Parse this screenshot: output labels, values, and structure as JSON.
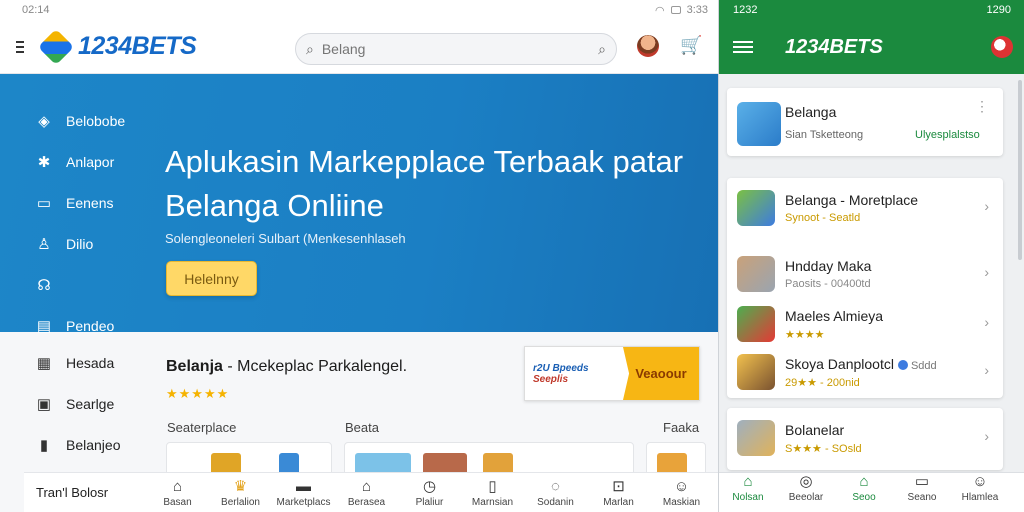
{
  "left": {
    "status_time": "02:14",
    "status_right": "3:33",
    "brand": "1234BETS",
    "search": {
      "placeholder": "Belang"
    },
    "side_menu": [
      {
        "label": "Belobobe",
        "icon": "leaf-icon"
      },
      {
        "label": "Anlapor",
        "icon": "puzzle-icon"
      },
      {
        "label": "Eenens",
        "icon": "laptop-icon"
      },
      {
        "label": "Dilio",
        "icon": "person-icon"
      },
      {
        "label": "",
        "icon": "headset-icon"
      },
      {
        "label": "Pendeo",
        "icon": "chart-icon"
      }
    ],
    "hero": {
      "title": "Aplukasin Markepplace Terbaak patar Belanga Onliine",
      "subtitle": "Solengleoneleri Sulbart (Menkesenhlaseh",
      "button": "Helelnny"
    },
    "lower_menu": [
      {
        "label": "Hesada",
        "icon": "storefront-icon"
      },
      {
        "label": "Searlge",
        "icon": "document-icon"
      },
      {
        "label": "Belanjeo",
        "icon": "bag-icon"
      }
    ],
    "section": {
      "title_bold": "Belanja",
      "title_rest": " - Mcekeplac Parkalengel.",
      "stars": "★★★★★",
      "col1": "Seaterplace",
      "col2": "Beata",
      "col3": "Faaka"
    },
    "promo": {
      "line1": "r2U Bpeeds",
      "line2": "Seeplis",
      "cta": "Veaoour"
    },
    "bottom_brand": "Tran'l Bolosr",
    "bottom_nav": [
      {
        "label": "Basan",
        "icon": "home-icon"
      },
      {
        "label": "Berlalion",
        "icon": "trophy-icon"
      },
      {
        "label": "Marketplacs",
        "icon": "controller-icon"
      },
      {
        "label": "Berasea",
        "icon": "home-outline-icon"
      },
      {
        "label": "Plaliur",
        "icon": "clock-icon"
      },
      {
        "label": "Marnsian",
        "icon": "tablet-icon"
      },
      {
        "label": "Sodanin",
        "icon": "chat-icon"
      },
      {
        "label": "Marlan",
        "icon": "grid-icon"
      },
      {
        "label": "Maskian",
        "icon": "user-icon"
      }
    ]
  },
  "right": {
    "status_time": "1232",
    "status_right": "1290",
    "brand": "1234BETS",
    "card1": {
      "title": "Belanga",
      "sub": "Sian Tsketteong",
      "status": "Ulyesplalstso"
    },
    "card2": [
      {
        "title": "Belanga - Moretplace",
        "sub": "Synoot - Seatld"
      },
      {
        "title": "Hndday Maka",
        "sub": "Paosits - 00400td"
      },
      {
        "title": "Maeles Almieya",
        "sub": "★★★★"
      },
      {
        "title": "Skoya Danplootcl",
        "badge_text": "Sddd",
        "sub": "29★★ - 200nid"
      }
    ],
    "card3": [
      {
        "title": "Bolanelar",
        "sub": "S★★★ - SOsld"
      },
      {
        "title": "",
        "sub": ""
      }
    ],
    "bottom_nav": [
      {
        "label": "Nolsan",
        "icon": "home-icon",
        "active": true
      },
      {
        "label": "Beeolar",
        "icon": "compass-icon"
      },
      {
        "label": "Seoo",
        "icon": "house-icon",
        "active": true
      },
      {
        "label": "Seano",
        "icon": "message-icon"
      },
      {
        "label": "Hlamlea",
        "icon": "user-icon"
      }
    ]
  },
  "colors": {
    "brand_blue": "#1569c7",
    "hero_blue": "#1d86c8",
    "mobile_green": "#1b8a3e",
    "button_yellow": "#ffd867",
    "star": "#f5b301"
  }
}
